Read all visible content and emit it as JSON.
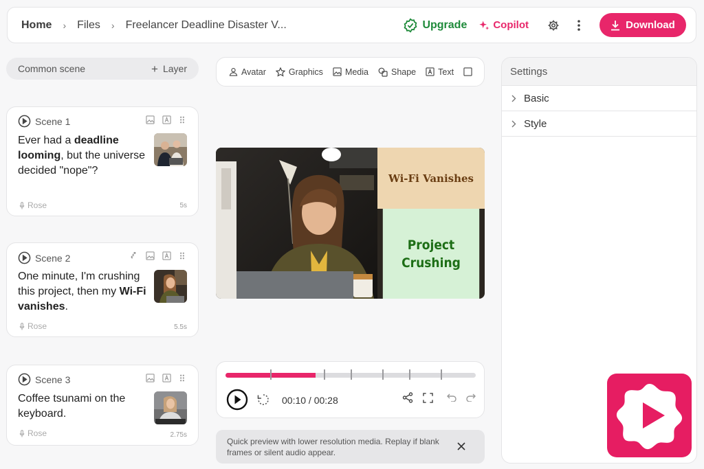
{
  "header": {
    "breadcrumbs": [
      "Home",
      "Files",
      "Freelancer Deadline Disaster V..."
    ],
    "upgrade_label": "Upgrade",
    "copilot_label": "Copilot",
    "download_label": "Download",
    "colors": {
      "accent": "#e8266a",
      "upgrade": "#1e8a3a"
    }
  },
  "left_panel": {
    "common_scene_label": "Common scene",
    "layer_label": "Layer"
  },
  "scenes": [
    {
      "title": "Scene 1",
      "text_segments": [
        {
          "text": "Ever had a ",
          "bold": false
        },
        {
          "text": "deadline looming",
          "bold": true
        },
        {
          "text": ", but the universe decided \"nope\"?",
          "bold": false
        }
      ],
      "voice": "Rose",
      "duration": "5s"
    },
    {
      "title": "Scene 2",
      "text_segments": [
        {
          "text": "One minute, I'm crushing this project, then my ",
          "bold": false
        },
        {
          "text": "Wi-Fi vanishes",
          "bold": true
        },
        {
          "text": ".",
          "bold": false
        }
      ],
      "voice": "Rose",
      "duration": "5.5s"
    },
    {
      "title": "Scene 3",
      "text_segments": [
        {
          "text": "Coffee tsunami on the keyboard.",
          "bold": false
        }
      ],
      "voice": "Rose",
      "duration": "2.75s"
    }
  ],
  "toolbar": {
    "items": [
      "Avatar",
      "Graphics",
      "Media",
      "Shape",
      "Text"
    ]
  },
  "preview": {
    "panel_top_text": "Wi-Fi Vanishes",
    "panel_bottom_line1": "Project",
    "panel_bottom_line2": "Crushing"
  },
  "player": {
    "time": "00:10 / 00:28",
    "progress": 0.36
  },
  "notice": {
    "text": "Quick preview with lower resolution media. Replay if blank frames or silent audio appear."
  },
  "settings": {
    "title": "Settings",
    "sections": [
      "Basic",
      "Style"
    ]
  }
}
